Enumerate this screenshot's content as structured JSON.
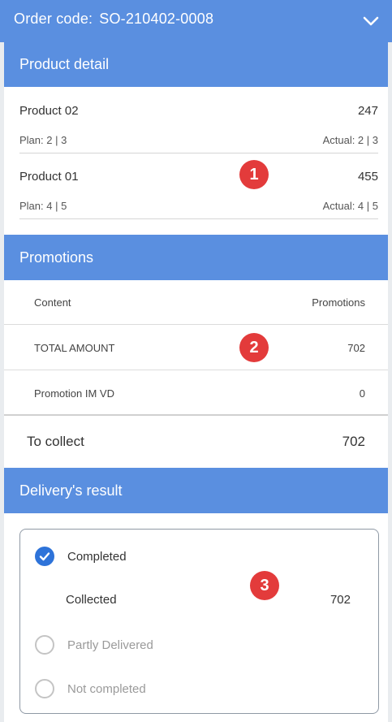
{
  "header": {
    "order_label": "Order code:",
    "order_code": "SO-210402-0008",
    "chevron_icon": "chevron-down-icon"
  },
  "product_detail": {
    "title": "Product detail",
    "products": [
      {
        "name": "Product 02",
        "value": "247",
        "plan": "Plan: 2 | 3",
        "actual": "Actual: 2 | 3"
      },
      {
        "name": "Product 01",
        "value": "455",
        "plan": "Plan: 4 | 5",
        "actual": "Actual: 4 | 5"
      }
    ]
  },
  "promotions": {
    "title": "Promotions",
    "columns": [
      "Content",
      "Promotions"
    ],
    "rows": [
      {
        "content": "TOTAL AMOUNT",
        "value": "702"
      },
      {
        "content": "Promotion IM VD",
        "value": "0"
      }
    ],
    "to_collect_label": "To collect",
    "to_collect_value": "702"
  },
  "delivery": {
    "title": "Delivery's result",
    "options": [
      {
        "label": "Completed",
        "selected": true
      },
      {
        "label": "Partly Delivered",
        "selected": false
      },
      {
        "label": "Not completed",
        "selected": false
      }
    ],
    "collected_label": "Collected",
    "collected_value": "702"
  },
  "markers": [
    "1",
    "2",
    "3"
  ],
  "colors": {
    "accent": "#5a8fe0",
    "radio_checked": "#2e73d9",
    "marker": "#e33b3b"
  }
}
